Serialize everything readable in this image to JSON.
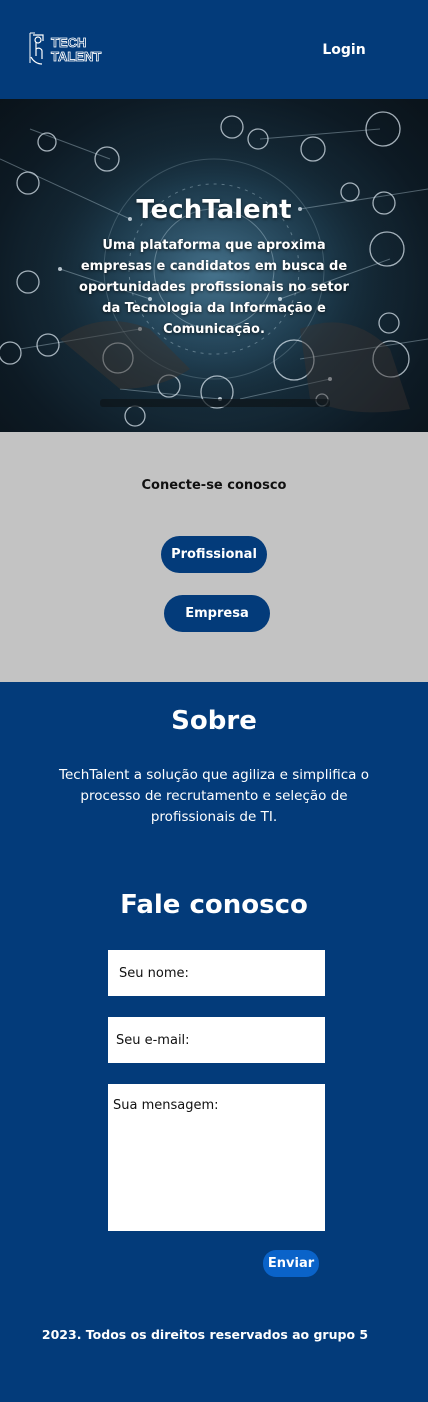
{
  "header": {
    "logo_alt": "TECH TALENT",
    "logo_line1": "TECH",
    "logo_line2": "TALENT",
    "login_label": "Login"
  },
  "hero": {
    "title": "TechTalent",
    "description": "Uma plataforma que aproxima empresas e candidatos em busca de oportunidades profissionais no setor da Tecnologia da Informação e Comunicação."
  },
  "connect": {
    "title": "Conecte-se conosco",
    "professional_label": "Profissional",
    "company_label": "Empresa"
  },
  "about": {
    "title": "Sobre",
    "text": "TechTalent a solução que agiliza e simplifica o processo de recrutamento e seleção de profissionais de TI."
  },
  "contact": {
    "title": "Fale conosco",
    "name_placeholder": "Seu nome:",
    "email_placeholder": "Seu e-mail:",
    "message_placeholder": "Sua mensagem:",
    "send_label": "Enviar"
  },
  "footer": {
    "text": "2023. Todos os direitos reservados ao grupo 5"
  },
  "colors": {
    "brand_blue": "#033b7a",
    "connect_bg": "#c3c3c3",
    "send_button": "#0a63c9"
  }
}
